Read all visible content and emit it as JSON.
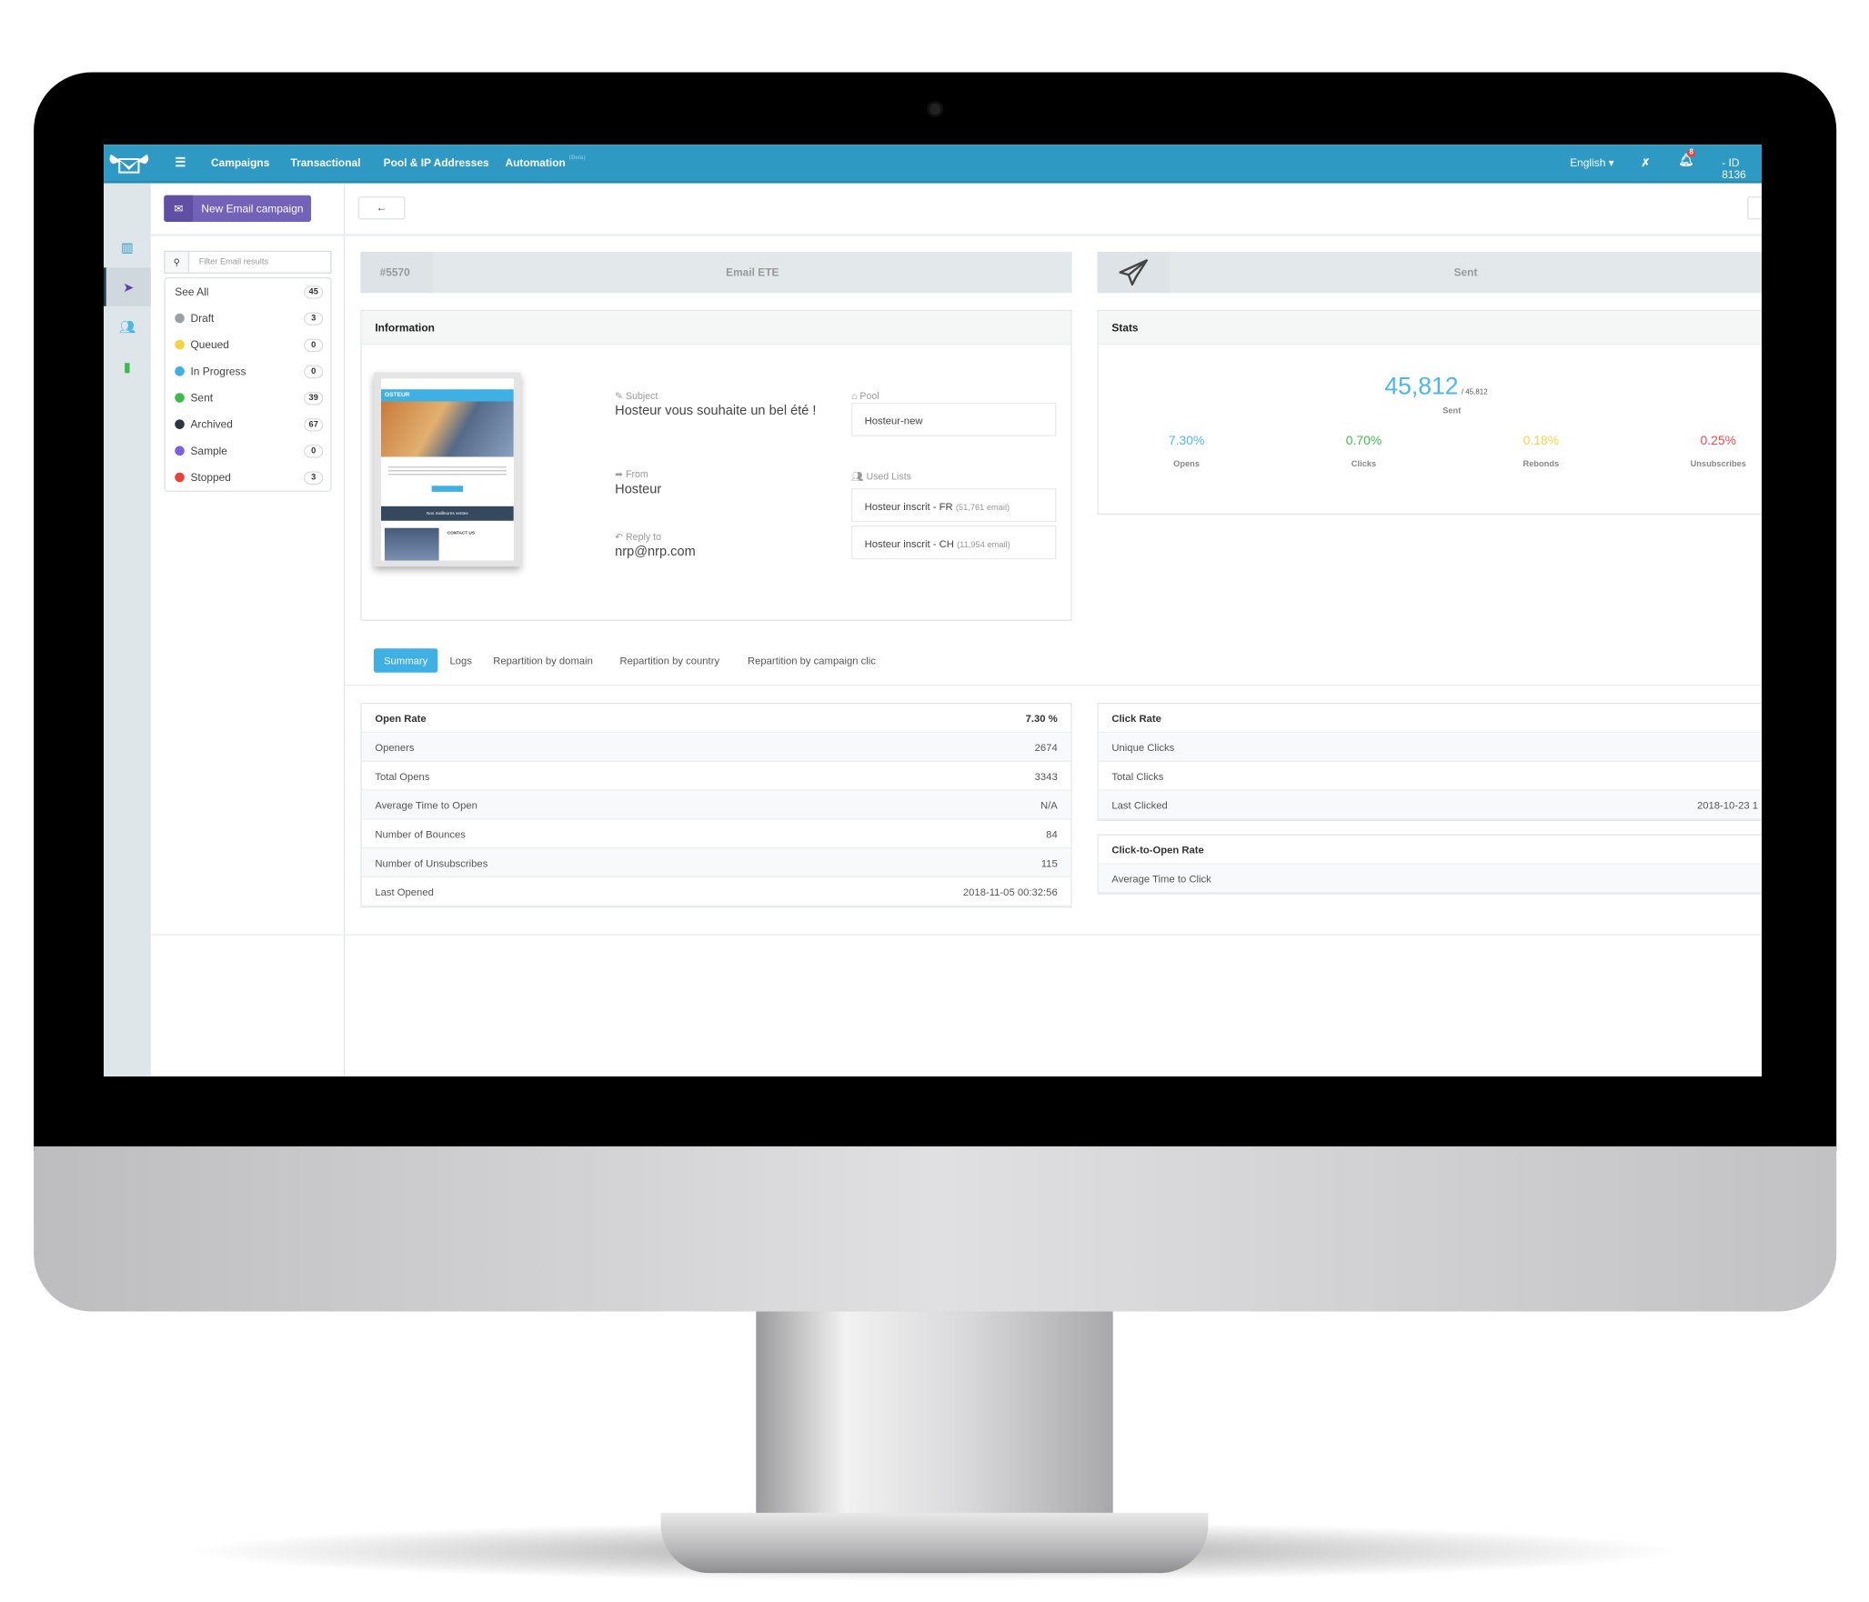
{
  "topbar": {
    "menu": [
      "Campaigns",
      "Transactional",
      "Pool & IP Addresses",
      "Automation"
    ],
    "beta": "(Beta)",
    "language": "English",
    "notifications": "8",
    "account": "- ID 8136",
    "color": "#2e9ac4"
  },
  "sidebar": {
    "new_campaign": "New Email campaign",
    "filter_placeholder": "Filter Email results",
    "items": [
      {
        "label": "See All",
        "count": "45",
        "color": ""
      },
      {
        "label": "Draft",
        "count": "3",
        "color": "#9aa0a6"
      },
      {
        "label": "Queued",
        "count": "0",
        "color": "#f5d442"
      },
      {
        "label": "In Progress",
        "count": "0",
        "color": "#3fb0e4"
      },
      {
        "label": "Sent",
        "count": "39",
        "color": "#3dbb4a"
      },
      {
        "label": "Archived",
        "count": "67",
        "color": "#2d3340"
      },
      {
        "label": "Sample",
        "count": "0",
        "color": "#7b5fe0"
      },
      {
        "label": "Stopped",
        "count": "3",
        "color": "#e8423a"
      }
    ]
  },
  "toolbar": {
    "back": "←"
  },
  "campaign": {
    "id": "#5570",
    "name": "Email ETE",
    "status": "Sent"
  },
  "information": {
    "title": "Information",
    "subject_label": "Subject",
    "subject": "Hosteur vous souhaite un bel été !",
    "from_label": "From",
    "from": "Hosteur",
    "reply_label": "Reply to",
    "reply": "nrp@nrp.com",
    "pool_label": "Pool",
    "pool": "Hosteur-new",
    "lists_label": "Used Lists",
    "lists": [
      {
        "name": "Hosteur inscrit - FR",
        "count": "(51,761 email)"
      },
      {
        "name": "Hosteur inscrit - CH",
        "count": "(11,954 email)"
      }
    ],
    "preview": {
      "brand": "OSTEUR",
      "banner": "Nos meilleures ventes",
      "contact": "CONTACT US"
    }
  },
  "stats": {
    "title": "Stats",
    "sent": "45,812",
    "total": "/ 45,812",
    "sent_label": "Sent",
    "metrics": [
      {
        "value": "7.30%",
        "label": "Opens",
        "color": "#4bb8e8"
      },
      {
        "value": "0.70%",
        "label": "Clicks",
        "color": "#3dbb4a"
      },
      {
        "value": "0.18%",
        "label": "Rebonds",
        "color": "#f5d442"
      },
      {
        "value": "0.25%",
        "label": "Unsubscribes",
        "color": "#f0454a"
      }
    ]
  },
  "tabs": [
    "Summary",
    "Logs",
    "Repartition by domain",
    "Repartition by country",
    "Repartition by campaign clic"
  ],
  "open_table": [
    [
      "Open Rate",
      "7.30 %"
    ],
    [
      "Openers",
      "2674"
    ],
    [
      "Total Opens",
      "3343"
    ],
    [
      "Average Time to Open",
      "N/A"
    ],
    [
      "Number of Bounces",
      "84"
    ],
    [
      "Number of Unsubscribes",
      "115"
    ],
    [
      "Last Opened",
      "2018-11-05 00:32:56"
    ]
  ],
  "click_table": [
    [
      "Click Rate",
      ""
    ],
    [
      "Unique Clicks",
      ""
    ],
    [
      "Total Clicks",
      ""
    ],
    [
      "Last Clicked",
      "2018-10-23 1"
    ]
  ],
  "cto_table": [
    [
      "Click-to-Open Rate",
      ""
    ],
    [
      "Average Time to Click",
      ""
    ]
  ]
}
